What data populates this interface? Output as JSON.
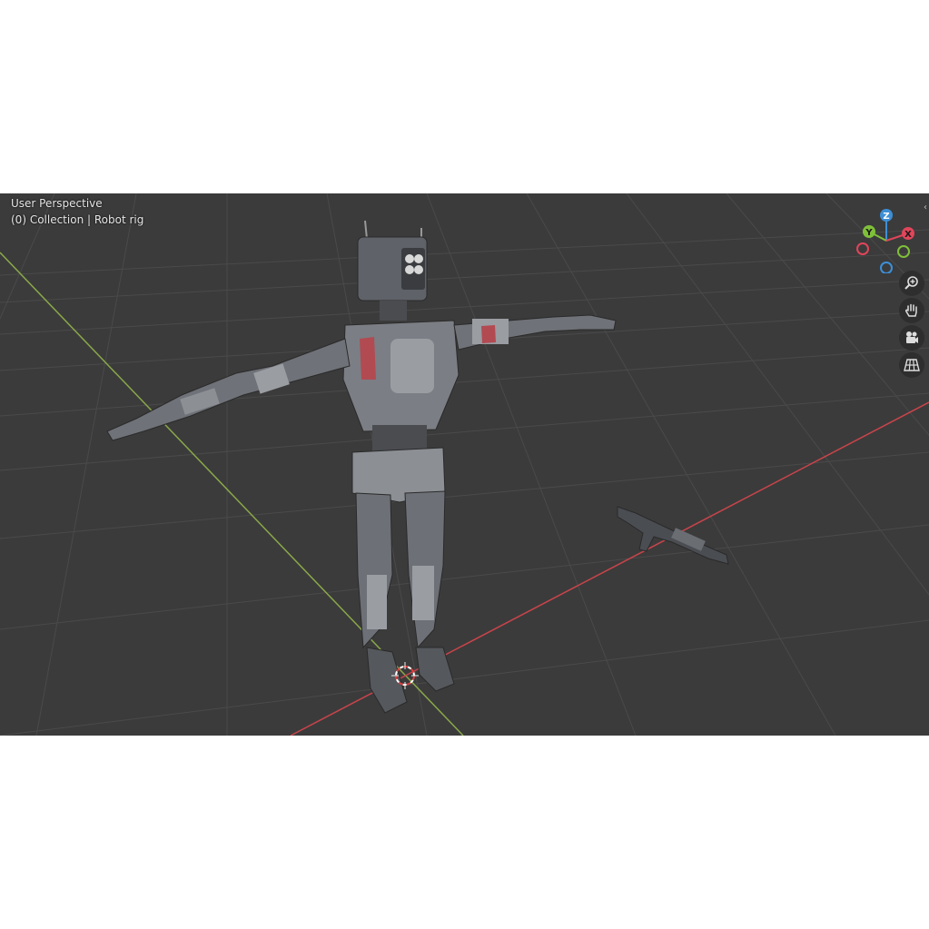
{
  "viewport": {
    "header_line1": "User Perspective",
    "header_line2": "(0) Collection | Robot rig"
  },
  "gizmo": {
    "z_label": "Z",
    "y_label": "Y",
    "x_label": "X",
    "colors": {
      "x": "#e0455a",
      "y": "#7fbf3a",
      "z": "#3d8fd6",
      "bg": "#3b3b3b"
    }
  },
  "nav_tools": [
    {
      "name": "zoom-icon"
    },
    {
      "name": "pan-hand-icon"
    },
    {
      "name": "camera-icon"
    },
    {
      "name": "perspective-grid-icon"
    }
  ],
  "scene": {
    "objects": [
      "robot-model",
      "rifle-model",
      "3d-cursor"
    ],
    "axis_colors": {
      "x": "#c9444b",
      "y": "#8aa84a"
    }
  }
}
